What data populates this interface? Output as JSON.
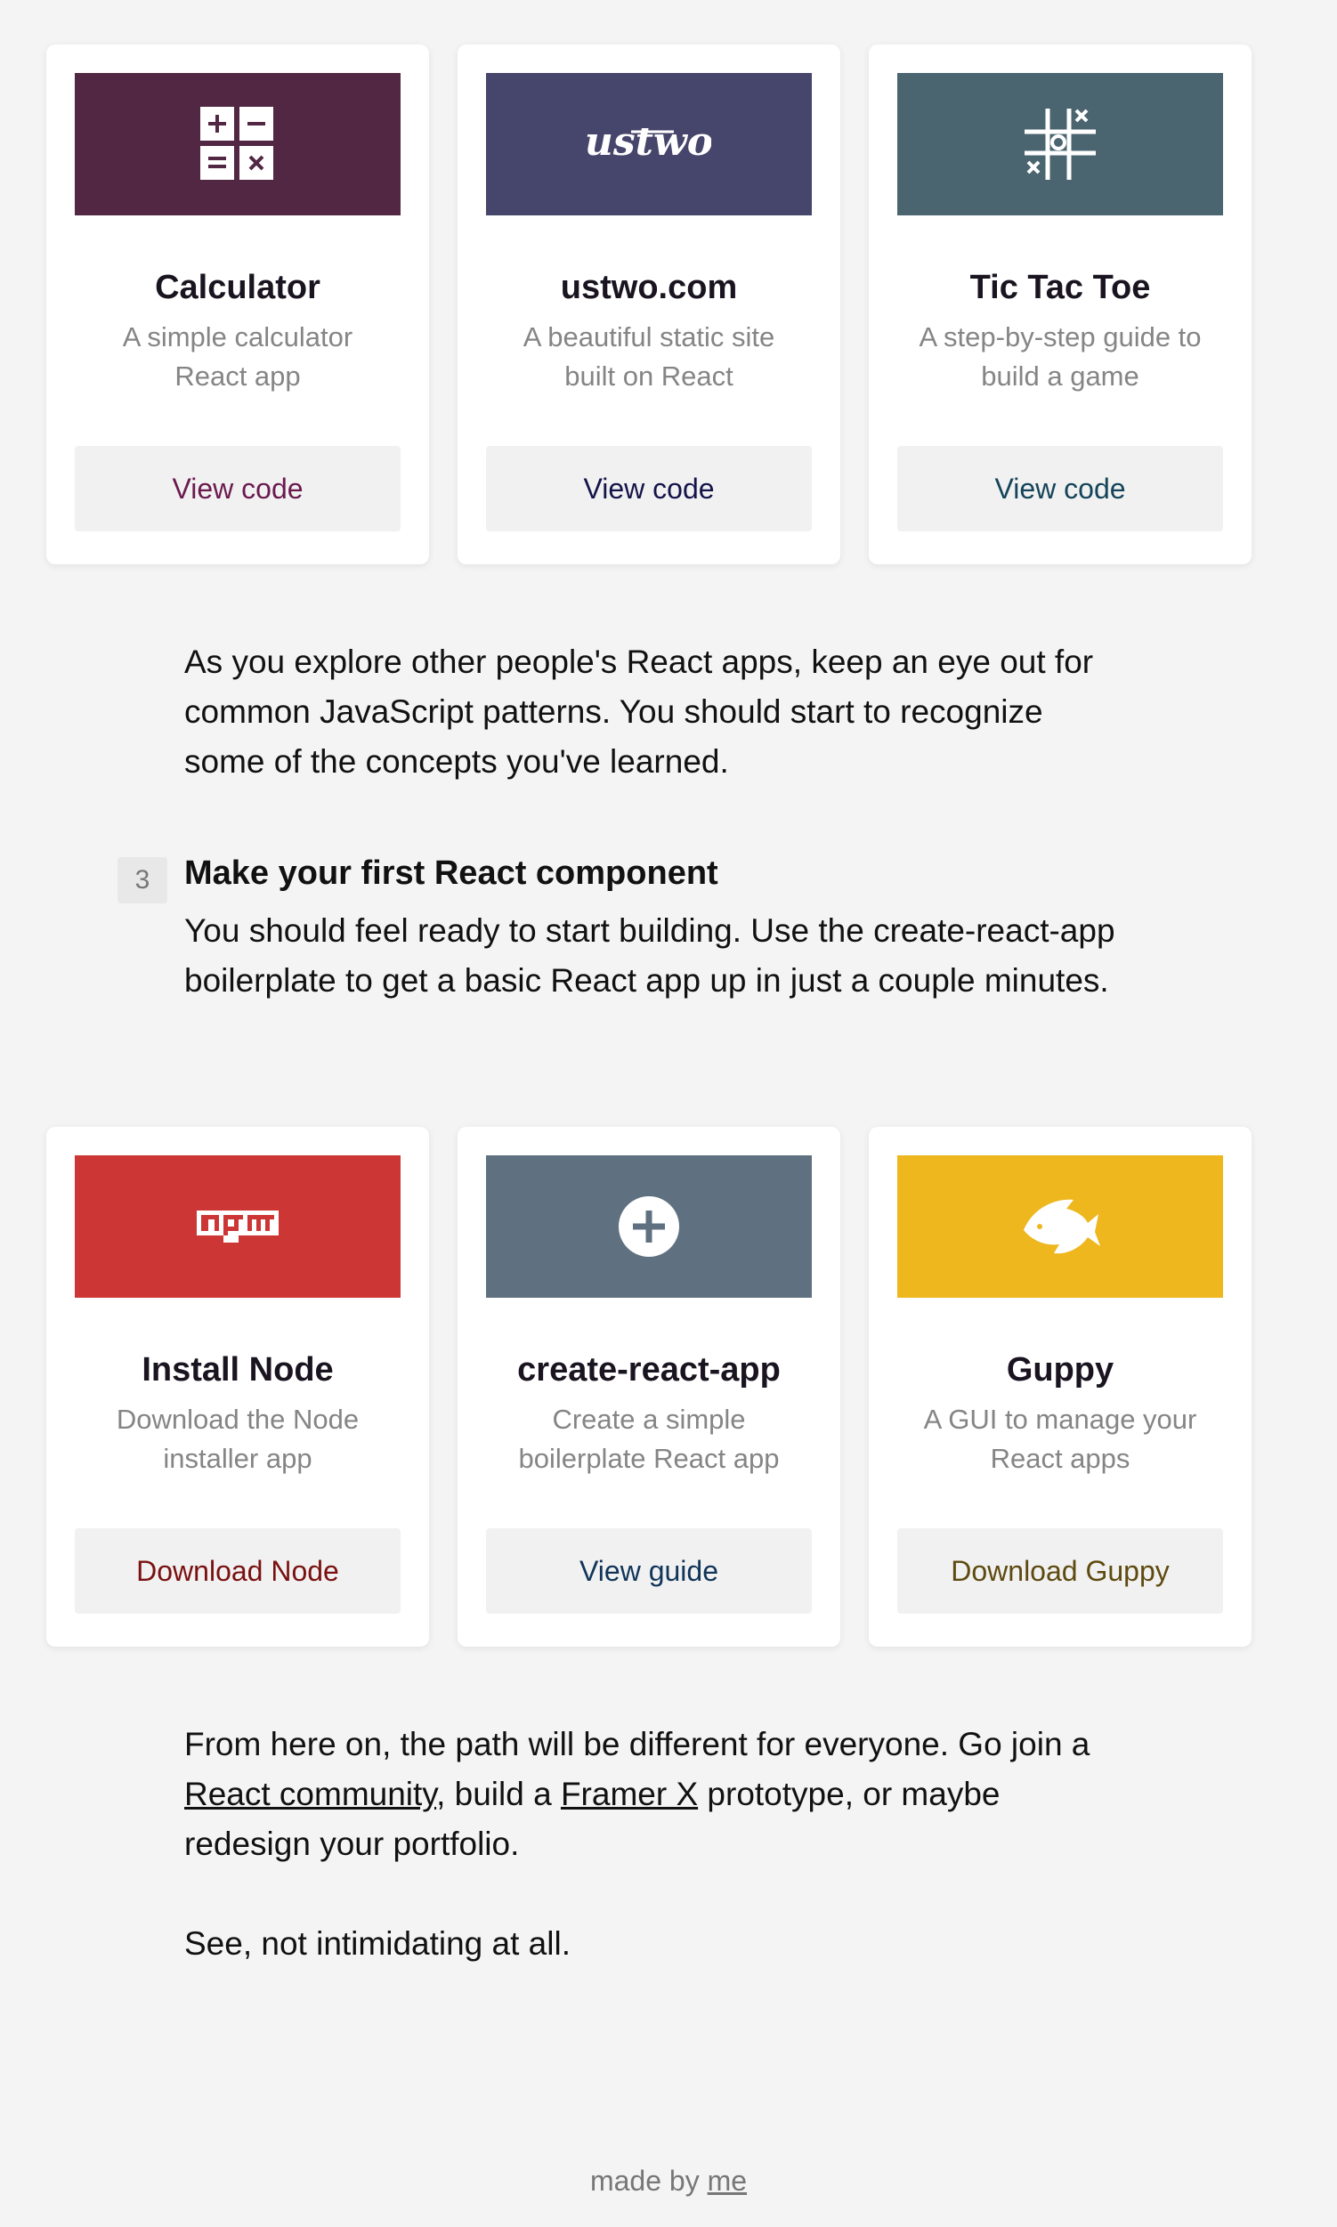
{
  "cards_top": [
    {
      "title": "Calculator",
      "desc": "A simple calculator React app",
      "button": "View code",
      "banner_color": "#522744",
      "button_color": "#6b1a4f",
      "icon": "calculator-icon"
    },
    {
      "title": "ustwo.com",
      "desc": "A beautiful static site built on React",
      "button": "View code",
      "banner_color": "#46456b",
      "button_color": "#14144a",
      "icon": "ustwo-logo",
      "logo_text": "ustwo"
    },
    {
      "title": "Tic Tac Toe",
      "desc": "A step-by-step guide to build a game",
      "button": "View code",
      "banner_color": "#4a6570",
      "button_color": "#15455a",
      "icon": "tic-tac-toe-icon"
    }
  ],
  "paragraph1": "As you explore other people's React apps, keep an eye out for common JavaScript patterns. You should start to recognize some of the concepts you've learned.",
  "step": {
    "number": "3",
    "title": "Make your first React component",
    "body": "You should feel ready to start building. Use the create-react-app boilerplate to get a basic React app up in just a couple minutes."
  },
  "cards_bottom": [
    {
      "title": "Install Node",
      "desc": "Download the Node installer app",
      "button": "Download Node",
      "banner_color": "#cc3634",
      "button_color": "#7a1010",
      "icon": "npm-logo"
    },
    {
      "title": "create-react-app",
      "desc": "Create a simple boilerplate React app",
      "button": "View guide",
      "banner_color": "#5f7181",
      "button_color": "#10355a",
      "icon": "plus-circle-icon"
    },
    {
      "title": "Guppy",
      "desc": "A GUI to manage your React apps",
      "button": "Download Guppy",
      "banner_color": "#eeb71e",
      "button_color": "#5e4a10",
      "icon": "guppy-fish-icon"
    }
  ],
  "paragraph2": {
    "part1": "From here on, the path will be different for everyone. Go join a ",
    "link1": "React community",
    "part2": ", build a ",
    "link2": "Framer X",
    "part3": " prototype, or maybe redesign your portfolio."
  },
  "paragraph3": "See, not intimidating at all.",
  "footer": {
    "text": "made by ",
    "link": "me"
  }
}
